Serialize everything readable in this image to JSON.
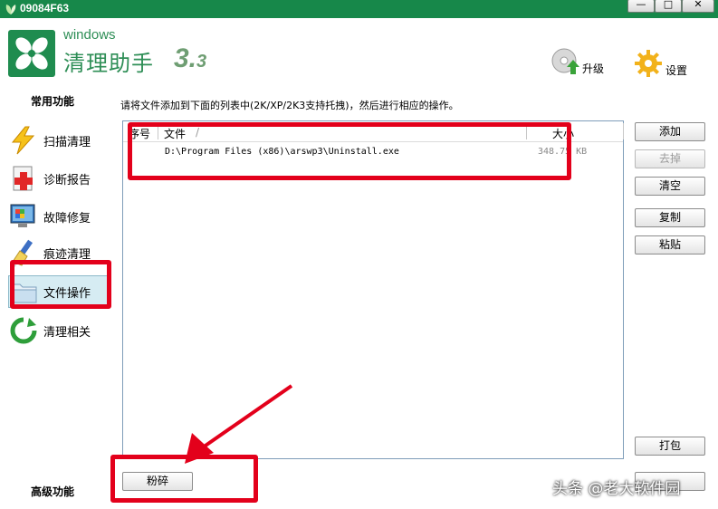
{
  "window": {
    "title": "09084F63",
    "minimize": "—",
    "maximize": "□",
    "close": "✕"
  },
  "brand": {
    "small": "windows",
    "name": "清理助手",
    "version": "3.",
    "version_minor": "3"
  },
  "header": {
    "upgrade_label": "升级",
    "settings_label": "设置"
  },
  "sidebar": {
    "common_heading": "常用功能",
    "advanced_heading": "高级功能",
    "items": [
      {
        "label": "扫描清理",
        "icon": "lightning-icon"
      },
      {
        "label": "诊断报告",
        "icon": "medical-report-icon"
      },
      {
        "label": "故障修复",
        "icon": "monitor-repair-icon"
      },
      {
        "label": "痕迹清理",
        "icon": "brush-icon"
      },
      {
        "label": "文件操作",
        "icon": "folder-icon"
      },
      {
        "label": "清理相关",
        "icon": "refresh-icon"
      }
    ]
  },
  "main": {
    "instruction": "请将文件添加到下面的列表中(2K/XP/2K3支持托拽)，然后进行相应的操作。",
    "columns": {
      "index": "序号",
      "file": "文件",
      "size": "大小"
    },
    "rows": [
      {
        "file": "D:\\Program Files (x86)\\arswp3\\Uninstall.exe",
        "size": "348.75 KB"
      }
    ],
    "buttons": {
      "add": "添加",
      "remove": "去掉",
      "clear": "清空",
      "copy": "复制",
      "paste": "粘贴",
      "pack": "打包",
      "shred": "粉碎"
    }
  },
  "watermark": "头条 @老大软件园",
  "colors": {
    "titlebar": "#17884a",
    "brand": "#2e8e56",
    "annotation": "#e3001b"
  }
}
